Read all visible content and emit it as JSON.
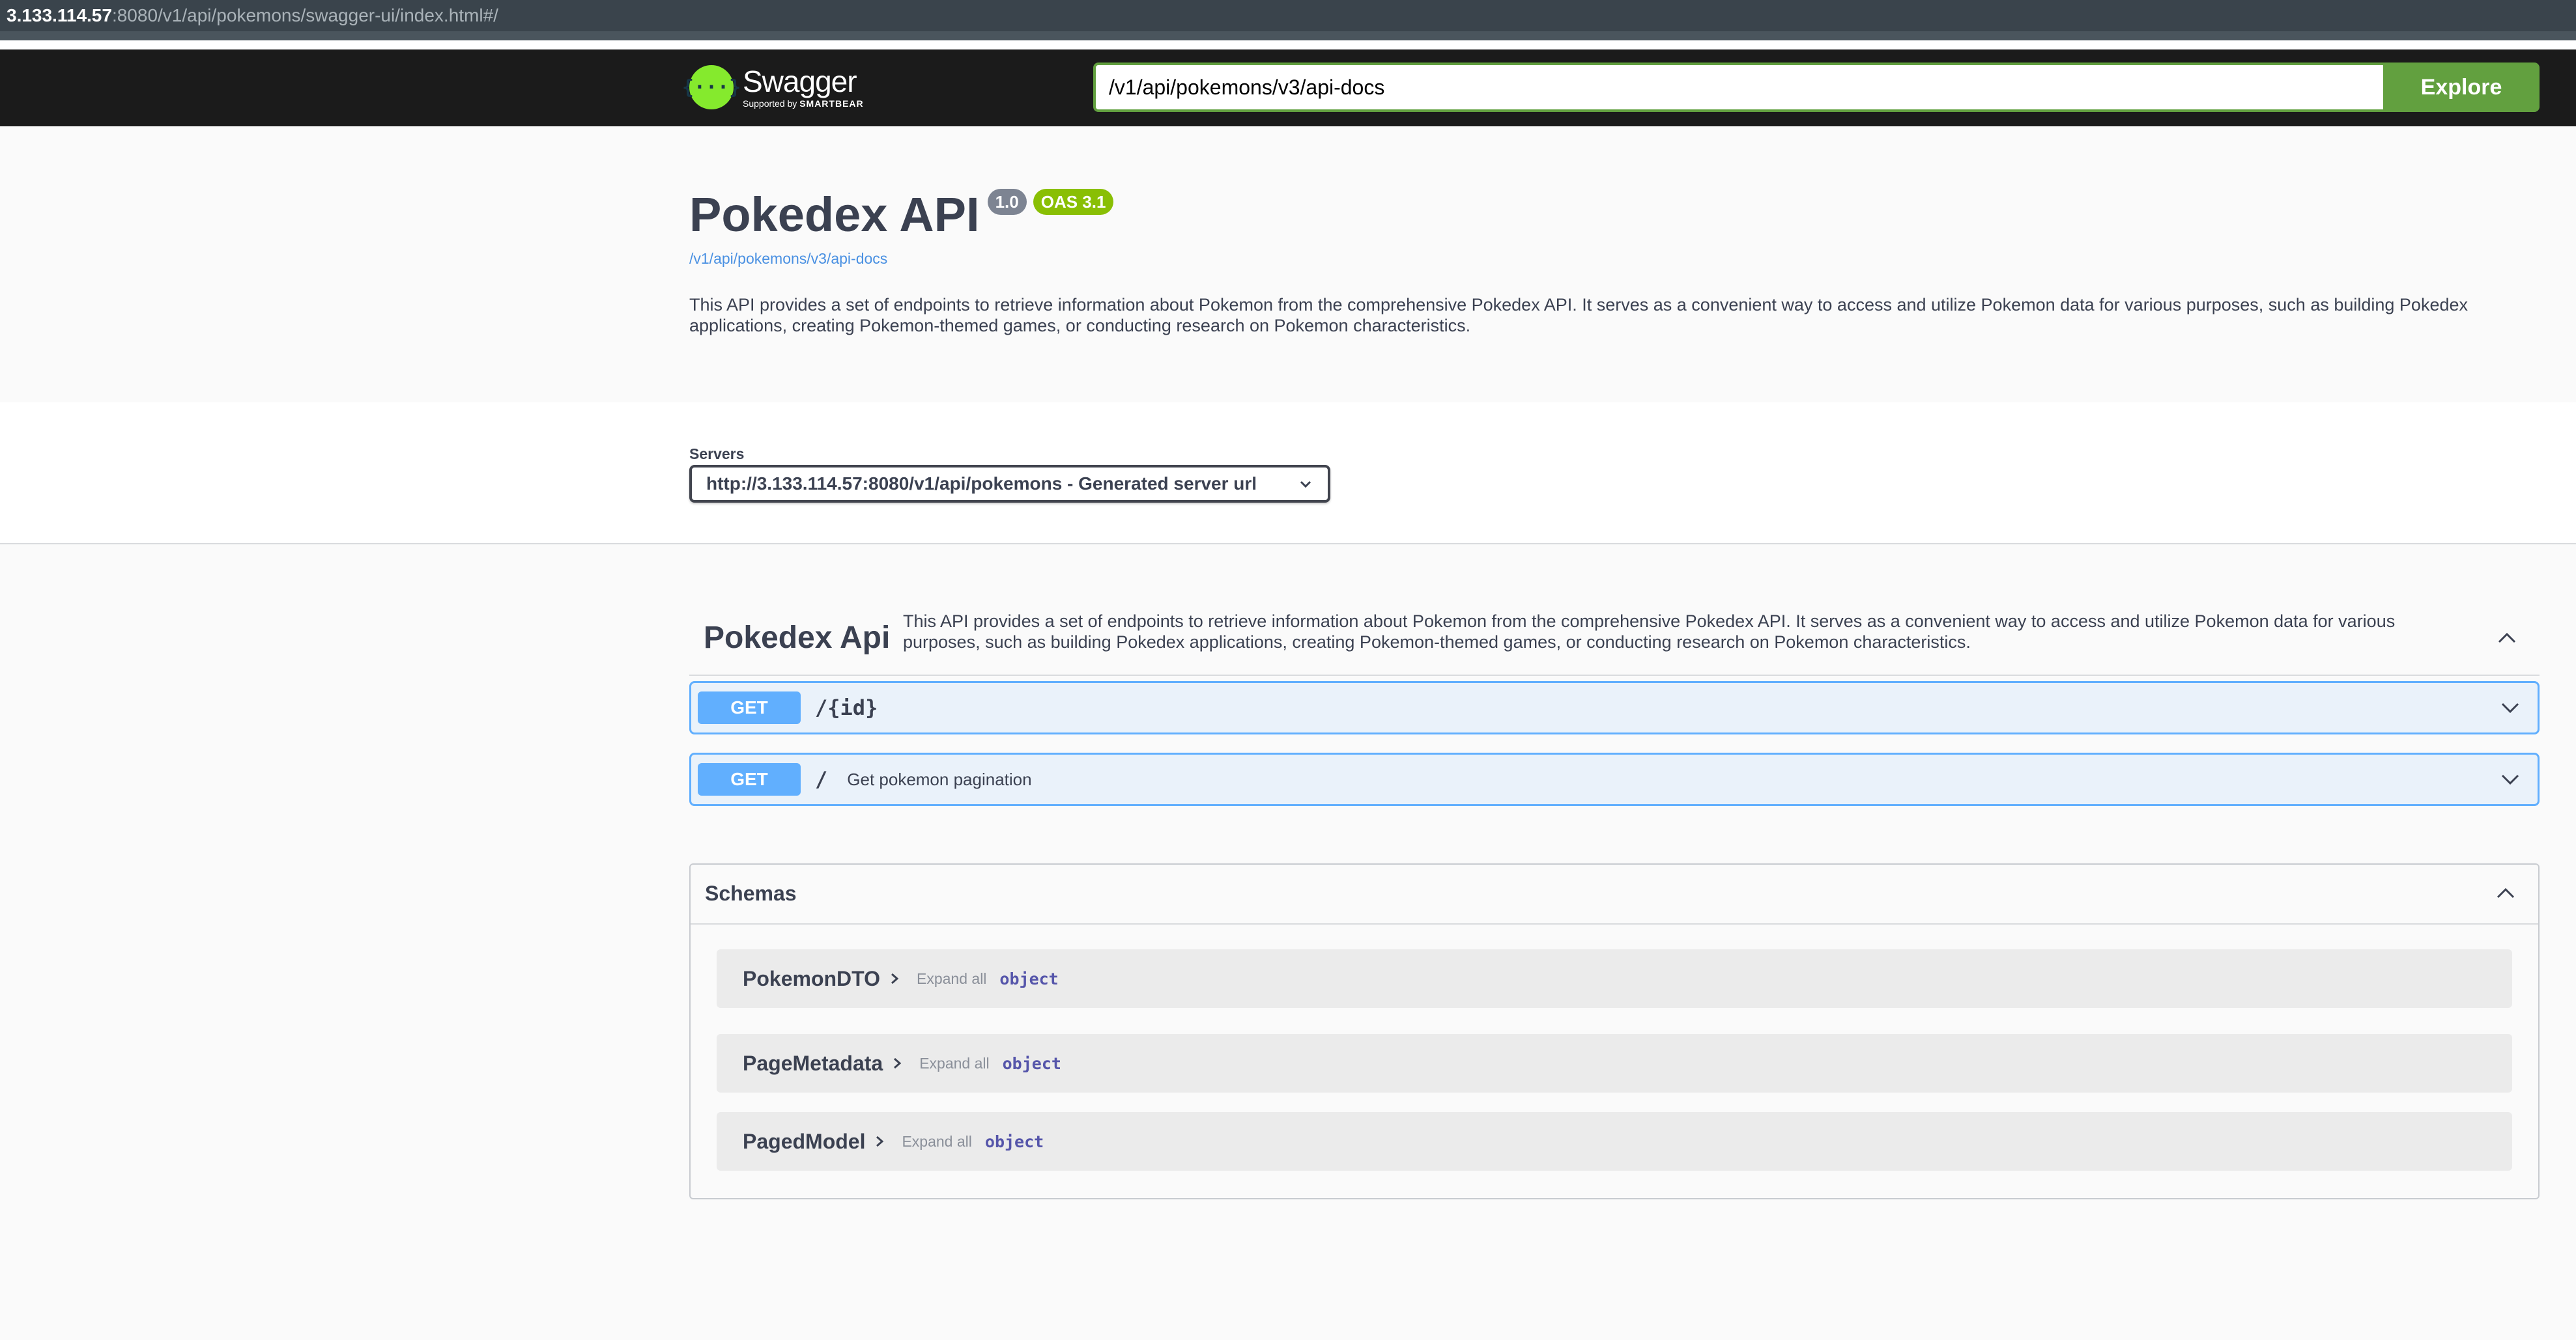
{
  "browser": {
    "url_host": "3.133.114.57",
    "url_rest": ":8080/v1/api/pokemons/swagger-ui/index.html#/"
  },
  "topbar": {
    "logo_mark": "{···}",
    "logo_name": "Swagger",
    "logo_supported": "Supported by",
    "logo_brand": "SMARTBEAR",
    "spec_url_value": "/v1/api/pokemons/v3/api-docs",
    "explore_label": "Explore"
  },
  "info": {
    "title": "Pokedex API",
    "version_badge": "1.0",
    "oas_badge": "OAS 3.1",
    "spec_link": "/v1/api/pokemons/v3/api-docs",
    "description": "This API provides a set of endpoints to retrieve information about Pokemon from the comprehensive Pokedex API. It serves as a convenient way to access and utilize Pokemon data for various purposes, such as building Pokedex applications, creating Pokemon-themed games, or conducting research on Pokemon characteristics."
  },
  "servers": {
    "label": "Servers",
    "selected": "http://3.133.114.57:8080/v1/api/pokemons - Generated server url"
  },
  "tag": {
    "name": "Pokedex Api",
    "description": "This API provides a set of endpoints to retrieve information about Pokemon from the comprehensive Pokedex API. It serves as a convenient way to access and utilize Pokemon data for various purposes, such as building Pokedex applications, creating Pokemon-themed games, or conducting research on Pokemon characteristics."
  },
  "operations": [
    {
      "method": "GET",
      "path": "/{id}",
      "summary": ""
    },
    {
      "method": "GET",
      "path": "/",
      "summary": "Get pokemon pagination"
    }
  ],
  "schemas": {
    "title": "Schemas",
    "models": [
      {
        "name": "PokemonDTO",
        "expand_all": "Expand all",
        "type": "object"
      },
      {
        "name": "PageMetadata",
        "expand_all": "Expand all",
        "type": "object"
      },
      {
        "name": "PagedModel",
        "expand_all": "Expand all",
        "type": "object"
      }
    ]
  },
  "colors": {
    "get_method": "#61affe",
    "explore_green": "#62a03f",
    "logo_green": "#85ea2d",
    "oas_badge": "#89bf04",
    "version_badge": "#7d8492"
  }
}
